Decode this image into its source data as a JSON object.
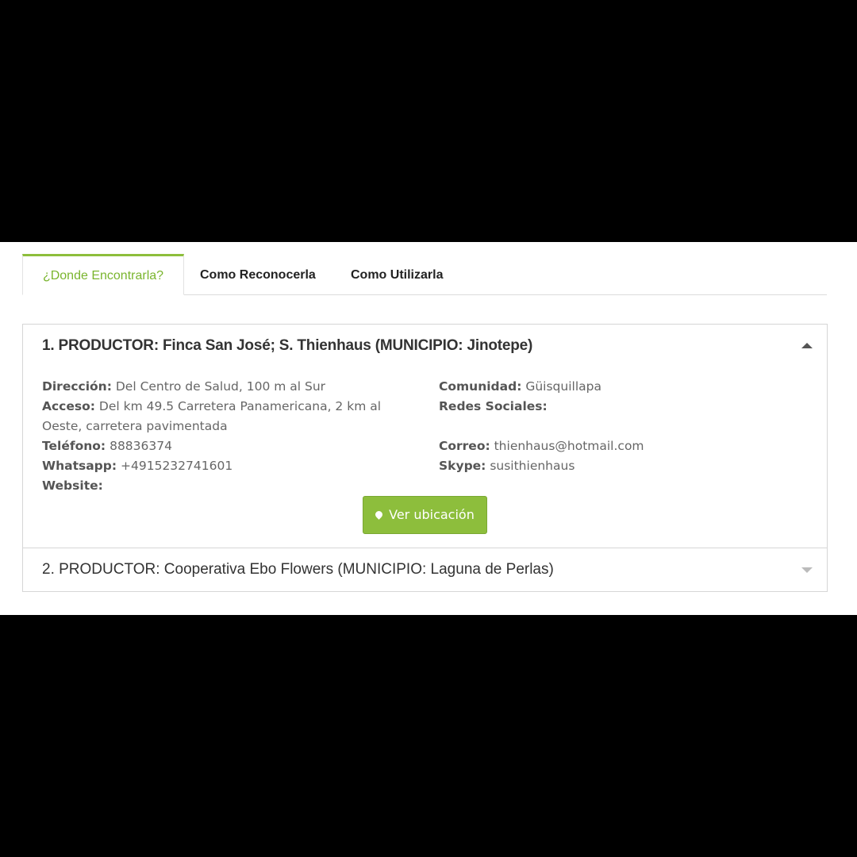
{
  "tabs": [
    {
      "label": "¿Donde Encontrarla?",
      "active": true
    },
    {
      "label": "Como Reconocerla",
      "active": false
    },
    {
      "label": "Como Utilizarla",
      "active": false
    }
  ],
  "producers": [
    {
      "title": "1. PRODUCTOR: Finca San José; S. Thienhaus (MUNICIPIO: Jinotepe)",
      "expanded": true,
      "left": {
        "direccion_label": "Dirección:",
        "direccion_value": "Del Centro de Salud, 100 m al Sur",
        "acceso_label": "Acceso:",
        "acceso_value": "Del km 49.5 Carretera Panamericana, 2 km al Oeste, carretera pavimentada",
        "telefono_label": "Teléfono:",
        "telefono_value": "88836374",
        "whatsapp_label": "Whatsapp:",
        "whatsapp_value": "+4915232741601",
        "website_label": "Website:",
        "website_value": ""
      },
      "right": {
        "comunidad_label": "Comunidad:",
        "comunidad_value": "Güisquillapa",
        "redes_label": "Redes Sociales:",
        "redes_value": "",
        "correo_label": "Correo:",
        "correo_value": "thienhaus@hotmail.com",
        "skype_label": "Skype:",
        "skype_value": "susithienhaus"
      },
      "button_label": "Ver ubicación",
      "button_icon": "map-marker-icon"
    },
    {
      "title": "2. PRODUCTOR: Cooperativa Ebo Flowers (MUNICIPIO: Laguna de Perlas)",
      "expanded": false
    }
  ],
  "colors": {
    "accent": "#8dbe3c",
    "border": "#d6d6d6"
  }
}
